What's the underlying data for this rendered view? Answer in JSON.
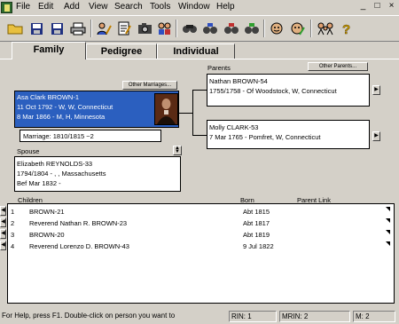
{
  "menu": [
    "File",
    "Edit",
    "Add",
    "View",
    "Search",
    "Tools",
    "Window",
    "Help"
  ],
  "window_buttons": [
    "_",
    "□",
    "×"
  ],
  "toolbar_icons": [
    "open-folder-icon",
    "save-icon",
    "save-as-icon",
    "print-icon",
    "edit-person-icon",
    "notes-icon",
    "scrapbook-icon",
    "add-family-icon",
    "find-icon",
    "find-family-icon",
    "find-tree-icon",
    "face-icon",
    "pencil-face-icon",
    "family-group-icon",
    "help-icon"
  ],
  "tabs": [
    "Family",
    "Pedigree",
    "Individual"
  ],
  "parents_label": "Parents",
  "other_parents_button": "Other Parents...",
  "other_marriages_button": "Other Marriages...",
  "main_person": {
    "name": "Asa Clark BROWN-1",
    "birth": "11 Oct 1792 - W, W, Connecticut",
    "death": "8 Mar 1866 - M, H, Minnesota"
  },
  "marriage": "Marriage: 1810/1815 ~2",
  "father": {
    "name": "Nathan BROWN-54",
    "dates": "1755/1758 - Of Woodstock, W, Connecticut"
  },
  "mother": {
    "name": "Molly CLARK-53",
    "dates": "7 Mar 1765 - Pomfret, W, Connecticut"
  },
  "spouse_label": "Spouse",
  "spouse": {
    "name": "Elizabeth REYNOLDS-33",
    "birth": "1794/1804 - , , Massachusetts",
    "death": "Bef Mar 1832 -"
  },
  "children_header": {
    "children": "Children",
    "born": "Born",
    "parent_link": "Parent Link"
  },
  "children": [
    {
      "num": "1",
      "name": "BROWN-21",
      "born": "Abt 1815"
    },
    {
      "num": "2",
      "name": "Reverend Nathan R. BROWN-23",
      "born": "Abt 1817"
    },
    {
      "num": "3",
      "name": "BROWN-20",
      "born": "Abt 1819"
    },
    {
      "num": "4",
      "name": "Reverend Lorenzo D. BROWN-43",
      "born": "9 Jul 1822"
    }
  ],
  "status": {
    "help": "For Help, press F1. Double-click on person you want to",
    "rin": "RIN: 1",
    "mrin": "MRIN: 2",
    "m": "M: 2"
  },
  "colors": {
    "selected_person_bg": "#2b5fbf",
    "chrome": "#d4d0c8"
  }
}
